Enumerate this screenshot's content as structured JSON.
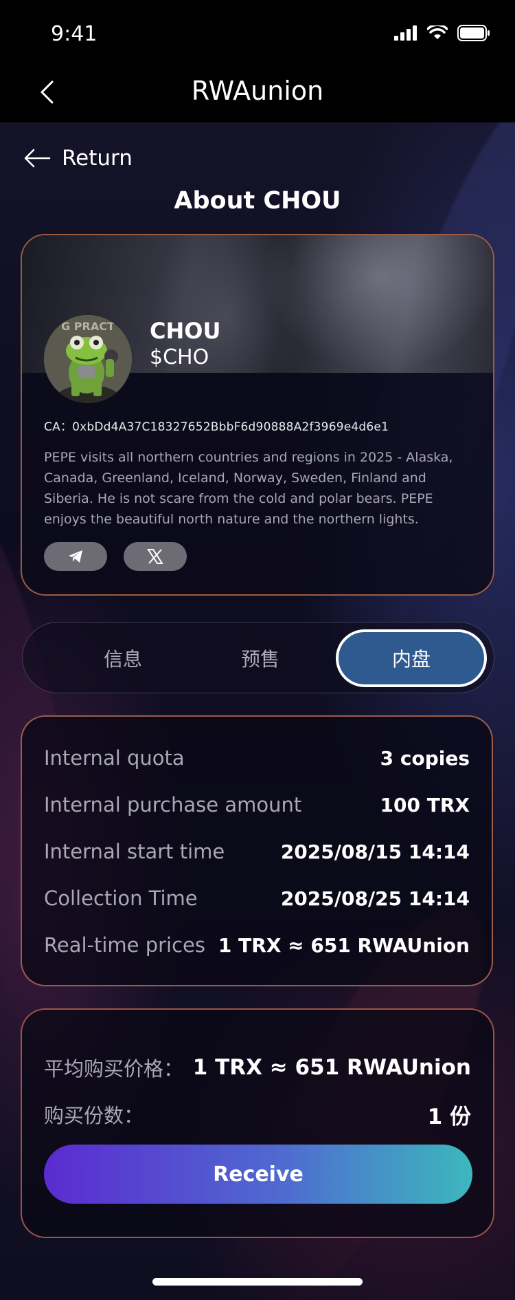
{
  "status_bar": {
    "time": "9:41"
  },
  "nav": {
    "title": "RWAunion"
  },
  "page": {
    "return_label": "Return",
    "title": "About CHOU"
  },
  "token": {
    "name": "CHOU",
    "symbol": "$CHO",
    "ca": "CA：0xbDd4A37C18327652BbbF6d90888A2f3969e4d6e1",
    "description": "PEPE visits all northern countries and regions in 2025 - Alaska, Canada, Greenland, Iceland, Norway, Sweden, Finland and Siberia. He is not scare from the cold and polar bears. PEPE enjoys the beautiful north nature and the northern lights.",
    "avatar_text": "G PRACT",
    "socials": [
      "telegram-icon",
      "x-icon"
    ]
  },
  "tabs": [
    {
      "label": "信息",
      "active": false
    },
    {
      "label": "预售",
      "active": false
    },
    {
      "label": "内盘",
      "active": true
    }
  ],
  "info": [
    {
      "label": "Internal quota",
      "value": "3 copies"
    },
    {
      "label": "Internal purchase amount",
      "value": "100 TRX"
    },
    {
      "label": "Internal start time",
      "value": "2025/08/15 14:14"
    },
    {
      "label": "Collection Time",
      "value": "2025/08/25 14:14"
    },
    {
      "label": "Real-time prices",
      "value": "1 TRX ≈ 651 RWAUnion"
    }
  ],
  "purchase": {
    "avg_price_label": "平均购买价格：",
    "avg_price_value": "1 TRX ≈ 651 RWAUnion",
    "copies_label": "购买份数：",
    "copies_value": "1 份",
    "button_label": "Receive"
  },
  "colors": {
    "card_border": "#cc7850",
    "active_tab": "#2f5a90",
    "button_gradient_start": "#5b2bd0",
    "button_gradient_end": "#3cb8bd"
  }
}
